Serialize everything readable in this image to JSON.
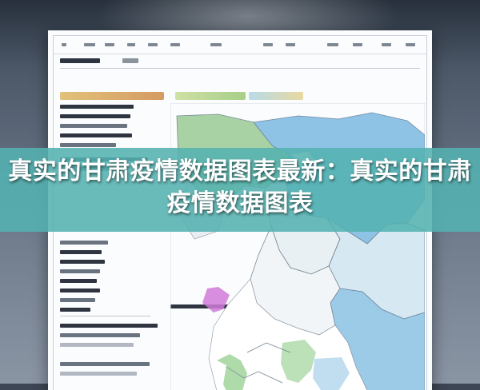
{
  "banner": {
    "title": "真实的甘肃疫情数据图表最新：真实的甘肃疫情数据图表"
  },
  "colors": {
    "banner": "#54b2b0",
    "region_blue": "#8ec3e6",
    "region_green": "#a6d7a2",
    "region_magenta": "#d07ad8"
  },
  "legend_swatches": [
    "green-region",
    "olive-region",
    "blue-region"
  ]
}
